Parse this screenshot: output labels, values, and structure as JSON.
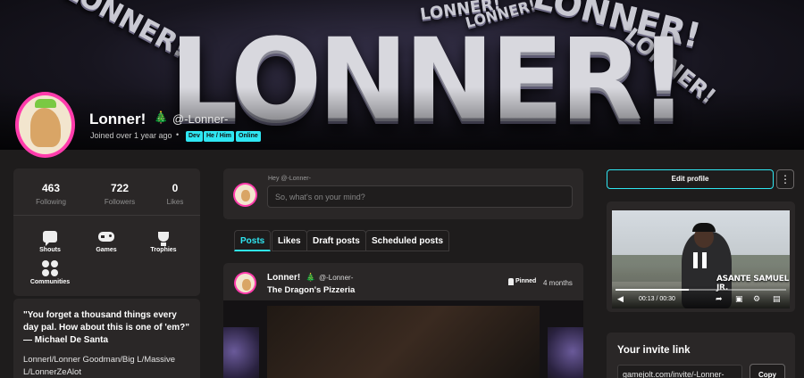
{
  "banner": {
    "headline": "LONNER!",
    "floating_words": [
      "LONNER!",
      "LONNER!",
      "LONNER!",
      "LONNER!",
      "LONNER!"
    ]
  },
  "profile": {
    "name": "Lonner!",
    "name_icon": "christmas-tree-icon",
    "handle": "@-Lonner-",
    "joined": "Joined over 1 year ago",
    "separator": "•",
    "tags": [
      "Dev",
      "He / Him",
      "Online"
    ],
    "tag_color": "#2fe6f2",
    "avatar_ring_color": "#ff3cac"
  },
  "stats": {
    "following": {
      "value": "463",
      "label": "Following"
    },
    "followers": {
      "value": "722",
      "label": "Followers"
    },
    "likes": {
      "value": "0",
      "label": "Likes"
    }
  },
  "shortcuts": [
    {
      "label": "Shouts",
      "icon": "speech-bubble-icon"
    },
    {
      "label": "Games",
      "icon": "gamepad-icon"
    },
    {
      "label": "Trophies",
      "icon": "trophy-icon"
    },
    {
      "label": "Communities",
      "icon": "communities-icon"
    }
  ],
  "bio": {
    "quote": "\"You forget a thousand things every day pal. How about this is one of 'em?\" — Michael De Santa",
    "aliases": "Lonnerl/Lonner Goodman/Big L/Massive L/LonnerZeAlot"
  },
  "composer": {
    "greeting": "Hey @-Lonner-",
    "placeholder": "So, what's on your mind?"
  },
  "tabs": [
    "Posts",
    "Likes",
    "Draft posts",
    "Scheduled posts"
  ],
  "active_tab": "Posts",
  "post": {
    "author": "Lonner!",
    "author_icon": "christmas-tree-icon",
    "handle": "@-Lonner-",
    "title": "The Dragon's Pizzeria",
    "pinned_label": "Pinned",
    "time": "4 months"
  },
  "sidebar": {
    "edit_profile": "Edit profile",
    "more": "⋮"
  },
  "video": {
    "caption": "ASANTE SAMUEL JR.",
    "time": "00:13 / 00:30",
    "progress": 0.43,
    "controls": [
      "mute-icon",
      "share-icon",
      "watch-later-icon",
      "settings-icon",
      "fullscreen-icon"
    ]
  },
  "invite": {
    "title": "Your invite link",
    "url": "gamejolt.com/invite/-Lonner-",
    "copy_label": "Copy"
  },
  "colors": {
    "accent": "#2fe6f2",
    "background": "#1e1c1c",
    "card": "#2a2727"
  }
}
